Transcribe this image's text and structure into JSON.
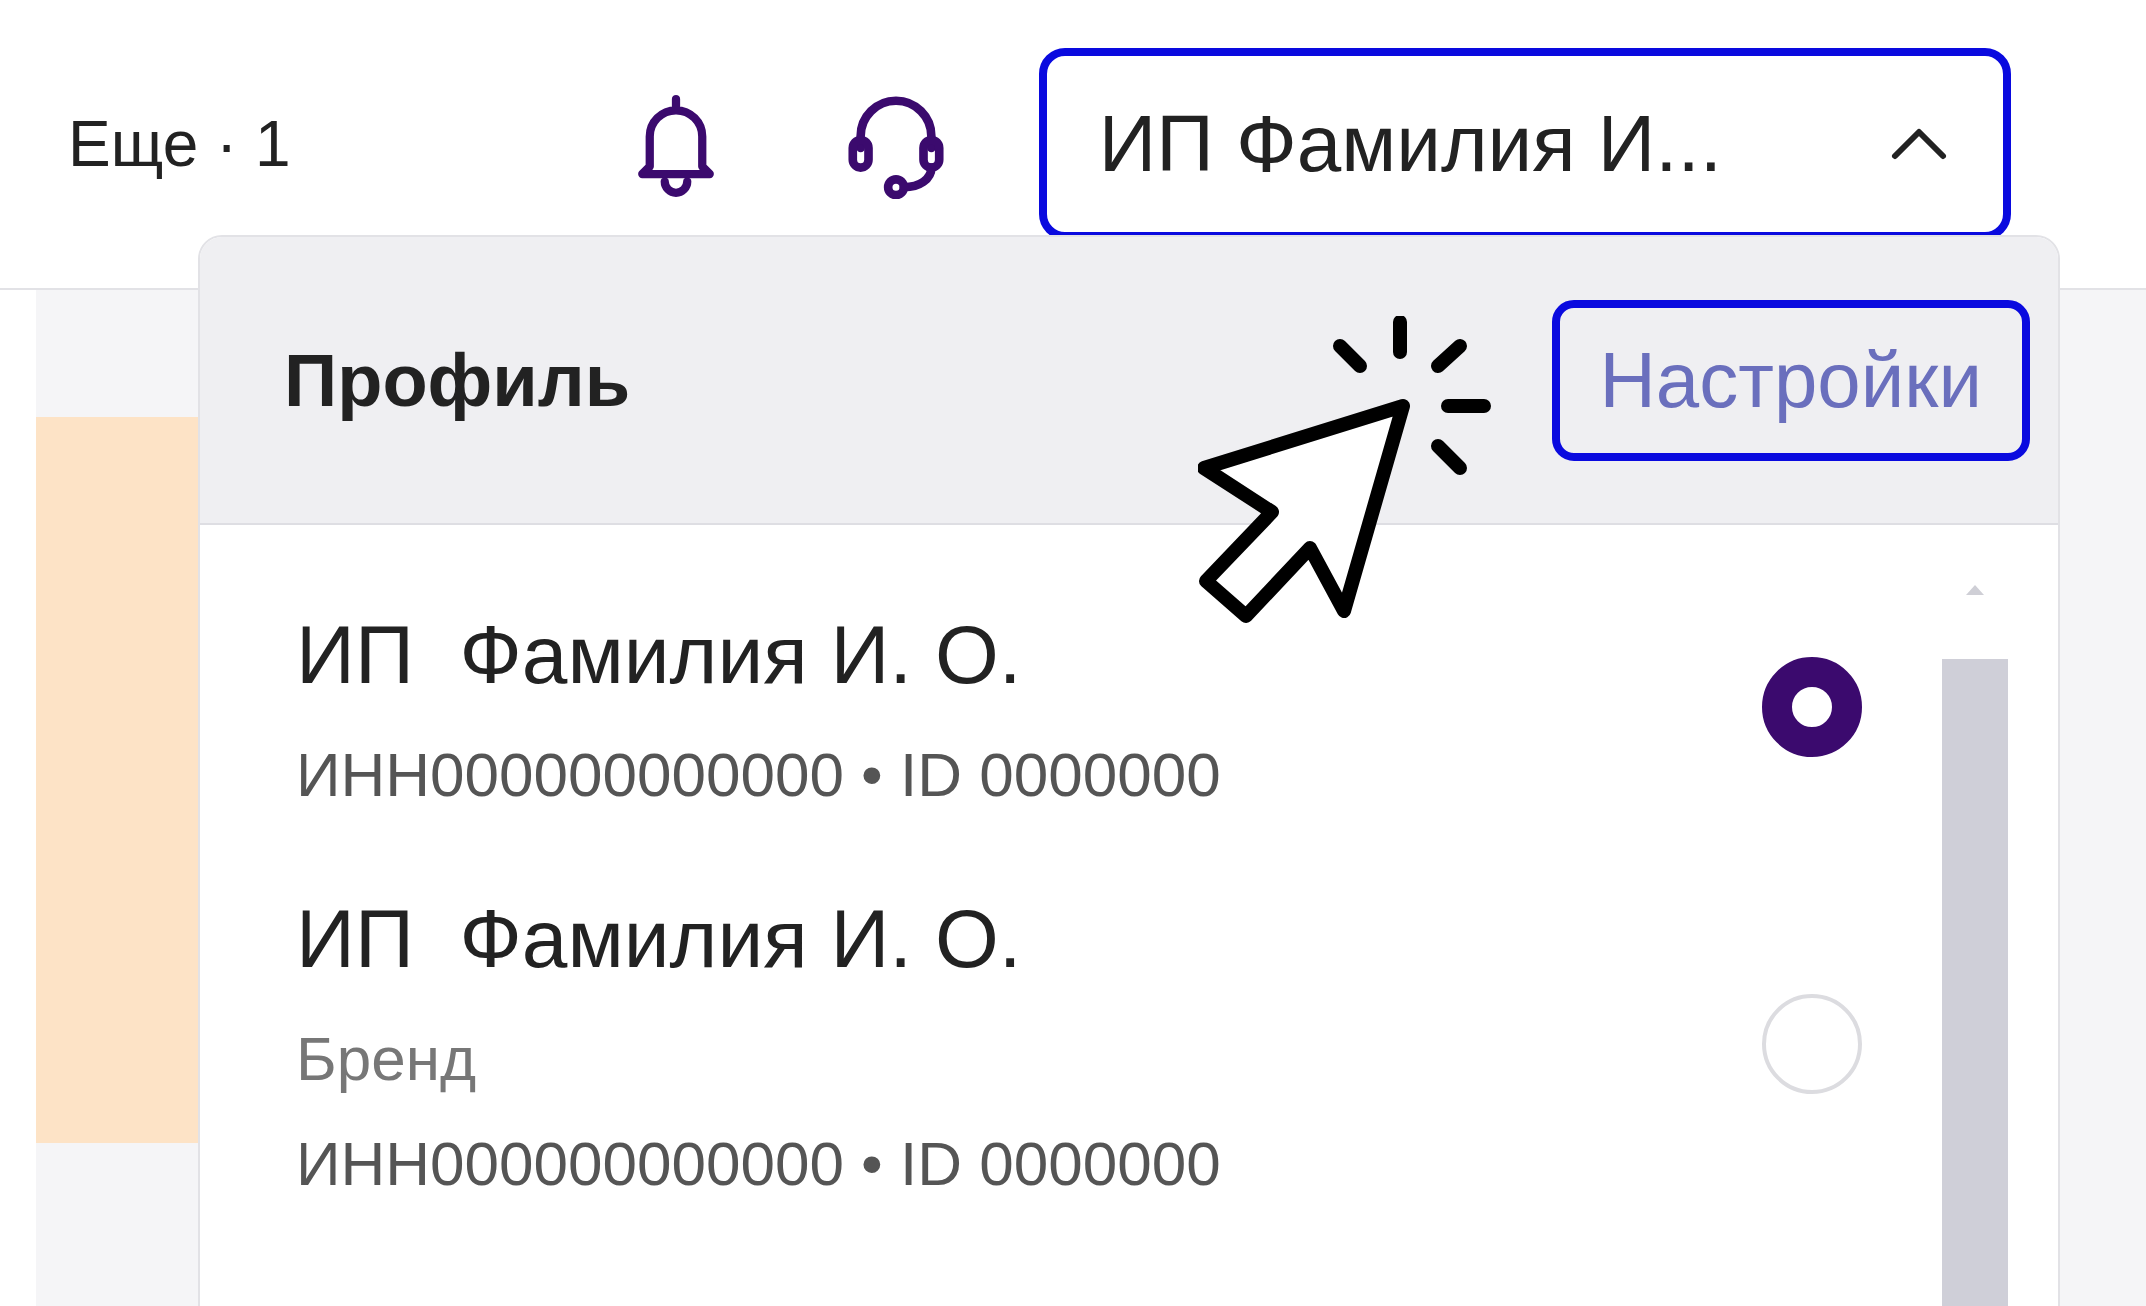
{
  "top_bar": {
    "more_label": "Еще · 1",
    "profile_button": {
      "label": "ИП Фамилия И...",
      "expanded": true
    }
  },
  "dropdown": {
    "title": "Профиль",
    "settings_link": "Настройки",
    "accounts": [
      {
        "name": "ИП  Фамилия И. О.",
        "details": "ИНН000000000000 • ID 0000000",
        "selected": true
      },
      {
        "name": "ИП  Фамилия И. О.",
        "brand": "Бренд",
        "details": "ИНН000000000000 • ID 0000000",
        "selected": false
      }
    ]
  }
}
